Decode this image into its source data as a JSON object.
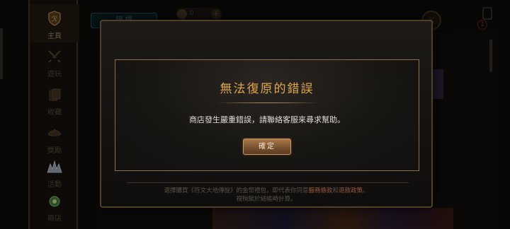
{
  "sidebar": {
    "items": [
      {
        "label": "主頁",
        "icon": "shield-icon",
        "active": true
      },
      {
        "label": "遊玩",
        "icon": "swords-icon",
        "active": false
      },
      {
        "label": "收藏",
        "icon": "collection-icon",
        "active": false
      },
      {
        "label": "獎勵",
        "icon": "rewards-icon",
        "active": false
      },
      {
        "label": "活動",
        "icon": "event-icon",
        "active": false
      },
      {
        "label": "商店",
        "icon": "shop-icon",
        "active": false
      }
    ]
  },
  "topbar": {
    "tab_label": "錦 標",
    "currency_value": "0",
    "currency_add": "+",
    "notification_count": "1"
  },
  "dialog": {
    "title": "無法復原的錯誤",
    "message": "商店發生嚴重錯誤，請聯絡客服來尋求幫助。",
    "confirm_label": "確定"
  },
  "footer": {
    "line1_prefix": "選擇購買《符文大地傳說》的金幣禮包，即代表你同意",
    "terms_link": "服務條款",
    "and": "和",
    "refund_link": "退款政策",
    "line1_suffix": "。",
    "line2": "視稅賦於結帳時計算。"
  },
  "colors": {
    "accent_gold": "#e0a64a",
    "button_fill": "#7a5230",
    "link_color": "#9a5a3a"
  }
}
